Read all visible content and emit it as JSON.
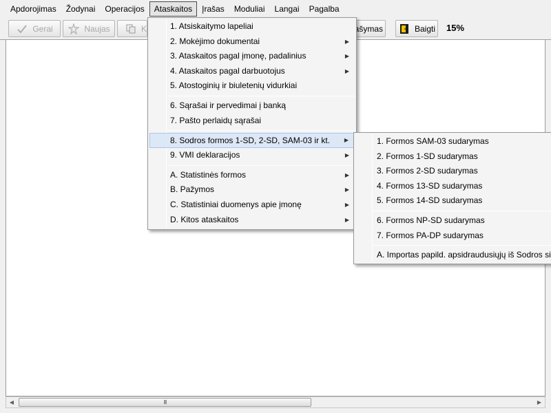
{
  "menubar": {
    "items": [
      "Apdorojimas",
      "Žodynai",
      "Operacijos",
      "Ataskaitos",
      "Įrašas",
      "Moduliai",
      "Langai",
      "Pagalba"
    ]
  },
  "toolbar": {
    "gerai_label": "Gerai",
    "naujas_label": "Naujas",
    "k_label": "K",
    "irasymas_label": "rašymas",
    "baigti_label": "Baigti",
    "percent": "15%"
  },
  "main_menu": {
    "items": [
      "1. Atsiskaitymo lapeliai",
      "2. Mokėjimo dokumentai",
      "3. Ataskaitos pagal įmonę, padalinius",
      "4. Ataskaitos pagal darbuotojus",
      "5. Atostoginių ir biuletenių vidurkiai",
      "6. Sąrašai ir pervedimai į banką",
      "7. Pašto perlaidų sąrašai",
      "8. Sodros formos 1-SD, 2-SD, SAM-03 ir kt.",
      "9. VMI deklaracijos",
      "A. Statistinės formos",
      "B. Pažymos",
      "C. Statistiniai duomenys apie įmonę",
      "D. Kitos ataskaitos"
    ]
  },
  "sub_menu": {
    "items": [
      "1. Formos SAM-03 sudarymas",
      "2. Formos 1-SD sudarymas",
      "3. Formos 2-SD sudarymas",
      "4. Formos 13-SD sudarymas",
      "5. Formos 14-SD sudarymas",
      "6. Formos NP-SD sudarymas",
      "7. Formos PA-DP sudarymas",
      "A. Importas papild. apsidraudusiųjų iš Sodros si"
    ]
  },
  "scrollbar": {
    "grip": "III"
  },
  "icons": {
    "submenu_arrow": "▶",
    "scroll_left": "◀",
    "scroll_right": "▶"
  }
}
